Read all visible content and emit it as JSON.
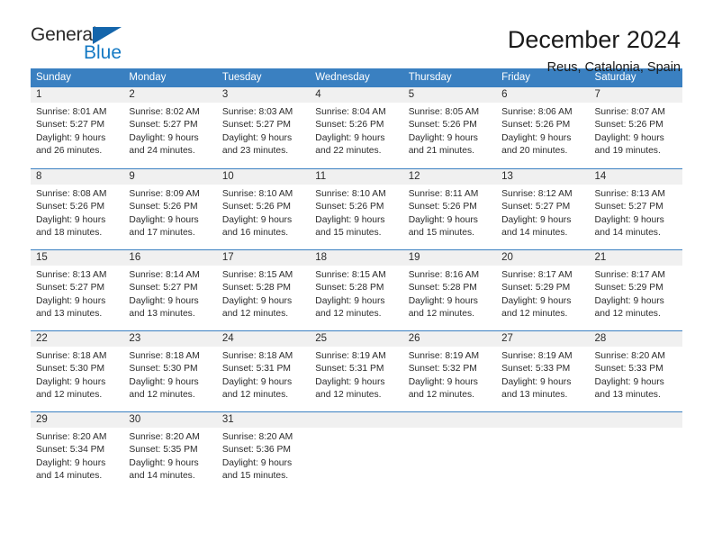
{
  "brand": {
    "name_part1": "General",
    "name_part2": "Blue",
    "triangle_color": "#1465ab",
    "blue_color": "#1479c4"
  },
  "header": {
    "title": "December 2024",
    "subtitle": "Reus, Catalonia, Spain"
  },
  "theme": {
    "header_blue": "#3a80c1",
    "daynum_gray": "#f0f0f0",
    "text_color": "#2b2b2b"
  },
  "weekdays": [
    "Sunday",
    "Monday",
    "Tuesday",
    "Wednesday",
    "Thursday",
    "Friday",
    "Saturday"
  ],
  "weeks": [
    [
      {
        "day": "1",
        "sunrise": "Sunrise: 8:01 AM",
        "sunset": "Sunset: 5:27 PM",
        "daylight1": "Daylight: 9 hours",
        "daylight2": "and 26 minutes."
      },
      {
        "day": "2",
        "sunrise": "Sunrise: 8:02 AM",
        "sunset": "Sunset: 5:27 PM",
        "daylight1": "Daylight: 9 hours",
        "daylight2": "and 24 minutes."
      },
      {
        "day": "3",
        "sunrise": "Sunrise: 8:03 AM",
        "sunset": "Sunset: 5:27 PM",
        "daylight1": "Daylight: 9 hours",
        "daylight2": "and 23 minutes."
      },
      {
        "day": "4",
        "sunrise": "Sunrise: 8:04 AM",
        "sunset": "Sunset: 5:26 PM",
        "daylight1": "Daylight: 9 hours",
        "daylight2": "and 22 minutes."
      },
      {
        "day": "5",
        "sunrise": "Sunrise: 8:05 AM",
        "sunset": "Sunset: 5:26 PM",
        "daylight1": "Daylight: 9 hours",
        "daylight2": "and 21 minutes."
      },
      {
        "day": "6",
        "sunrise": "Sunrise: 8:06 AM",
        "sunset": "Sunset: 5:26 PM",
        "daylight1": "Daylight: 9 hours",
        "daylight2": "and 20 minutes."
      },
      {
        "day": "7",
        "sunrise": "Sunrise: 8:07 AM",
        "sunset": "Sunset: 5:26 PM",
        "daylight1": "Daylight: 9 hours",
        "daylight2": "and 19 minutes."
      }
    ],
    [
      {
        "day": "8",
        "sunrise": "Sunrise: 8:08 AM",
        "sunset": "Sunset: 5:26 PM",
        "daylight1": "Daylight: 9 hours",
        "daylight2": "and 18 minutes."
      },
      {
        "day": "9",
        "sunrise": "Sunrise: 8:09 AM",
        "sunset": "Sunset: 5:26 PM",
        "daylight1": "Daylight: 9 hours",
        "daylight2": "and 17 minutes."
      },
      {
        "day": "10",
        "sunrise": "Sunrise: 8:10 AM",
        "sunset": "Sunset: 5:26 PM",
        "daylight1": "Daylight: 9 hours",
        "daylight2": "and 16 minutes."
      },
      {
        "day": "11",
        "sunrise": "Sunrise: 8:10 AM",
        "sunset": "Sunset: 5:26 PM",
        "daylight1": "Daylight: 9 hours",
        "daylight2": "and 15 minutes."
      },
      {
        "day": "12",
        "sunrise": "Sunrise: 8:11 AM",
        "sunset": "Sunset: 5:26 PM",
        "daylight1": "Daylight: 9 hours",
        "daylight2": "and 15 minutes."
      },
      {
        "day": "13",
        "sunrise": "Sunrise: 8:12 AM",
        "sunset": "Sunset: 5:27 PM",
        "daylight1": "Daylight: 9 hours",
        "daylight2": "and 14 minutes."
      },
      {
        "day": "14",
        "sunrise": "Sunrise: 8:13 AM",
        "sunset": "Sunset: 5:27 PM",
        "daylight1": "Daylight: 9 hours",
        "daylight2": "and 14 minutes."
      }
    ],
    [
      {
        "day": "15",
        "sunrise": "Sunrise: 8:13 AM",
        "sunset": "Sunset: 5:27 PM",
        "daylight1": "Daylight: 9 hours",
        "daylight2": "and 13 minutes."
      },
      {
        "day": "16",
        "sunrise": "Sunrise: 8:14 AM",
        "sunset": "Sunset: 5:27 PM",
        "daylight1": "Daylight: 9 hours",
        "daylight2": "and 13 minutes."
      },
      {
        "day": "17",
        "sunrise": "Sunrise: 8:15 AM",
        "sunset": "Sunset: 5:28 PM",
        "daylight1": "Daylight: 9 hours",
        "daylight2": "and 12 minutes."
      },
      {
        "day": "18",
        "sunrise": "Sunrise: 8:15 AM",
        "sunset": "Sunset: 5:28 PM",
        "daylight1": "Daylight: 9 hours",
        "daylight2": "and 12 minutes."
      },
      {
        "day": "19",
        "sunrise": "Sunrise: 8:16 AM",
        "sunset": "Sunset: 5:28 PM",
        "daylight1": "Daylight: 9 hours",
        "daylight2": "and 12 minutes."
      },
      {
        "day": "20",
        "sunrise": "Sunrise: 8:17 AM",
        "sunset": "Sunset: 5:29 PM",
        "daylight1": "Daylight: 9 hours",
        "daylight2": "and 12 minutes."
      },
      {
        "day": "21",
        "sunrise": "Sunrise: 8:17 AM",
        "sunset": "Sunset: 5:29 PM",
        "daylight1": "Daylight: 9 hours",
        "daylight2": "and 12 minutes."
      }
    ],
    [
      {
        "day": "22",
        "sunrise": "Sunrise: 8:18 AM",
        "sunset": "Sunset: 5:30 PM",
        "daylight1": "Daylight: 9 hours",
        "daylight2": "and 12 minutes."
      },
      {
        "day": "23",
        "sunrise": "Sunrise: 8:18 AM",
        "sunset": "Sunset: 5:30 PM",
        "daylight1": "Daylight: 9 hours",
        "daylight2": "and 12 minutes."
      },
      {
        "day": "24",
        "sunrise": "Sunrise: 8:18 AM",
        "sunset": "Sunset: 5:31 PM",
        "daylight1": "Daylight: 9 hours",
        "daylight2": "and 12 minutes."
      },
      {
        "day": "25",
        "sunrise": "Sunrise: 8:19 AM",
        "sunset": "Sunset: 5:31 PM",
        "daylight1": "Daylight: 9 hours",
        "daylight2": "and 12 minutes."
      },
      {
        "day": "26",
        "sunrise": "Sunrise: 8:19 AM",
        "sunset": "Sunset: 5:32 PM",
        "daylight1": "Daylight: 9 hours",
        "daylight2": "and 12 minutes."
      },
      {
        "day": "27",
        "sunrise": "Sunrise: 8:19 AM",
        "sunset": "Sunset: 5:33 PM",
        "daylight1": "Daylight: 9 hours",
        "daylight2": "and 13 minutes."
      },
      {
        "day": "28",
        "sunrise": "Sunrise: 8:20 AM",
        "sunset": "Sunset: 5:33 PM",
        "daylight1": "Daylight: 9 hours",
        "daylight2": "and 13 minutes."
      }
    ],
    [
      {
        "day": "29",
        "sunrise": "Sunrise: 8:20 AM",
        "sunset": "Sunset: 5:34 PM",
        "daylight1": "Daylight: 9 hours",
        "daylight2": "and 14 minutes."
      },
      {
        "day": "30",
        "sunrise": "Sunrise: 8:20 AM",
        "sunset": "Sunset: 5:35 PM",
        "daylight1": "Daylight: 9 hours",
        "daylight2": "and 14 minutes."
      },
      {
        "day": "31",
        "sunrise": "Sunrise: 8:20 AM",
        "sunset": "Sunset: 5:36 PM",
        "daylight1": "Daylight: 9 hours",
        "daylight2": "and 15 minutes."
      },
      {
        "day": "",
        "sunrise": "",
        "sunset": "",
        "daylight1": "",
        "daylight2": ""
      },
      {
        "day": "",
        "sunrise": "",
        "sunset": "",
        "daylight1": "",
        "daylight2": ""
      },
      {
        "day": "",
        "sunrise": "",
        "sunset": "",
        "daylight1": "",
        "daylight2": ""
      },
      {
        "day": "",
        "sunrise": "",
        "sunset": "",
        "daylight1": "",
        "daylight2": ""
      }
    ]
  ]
}
